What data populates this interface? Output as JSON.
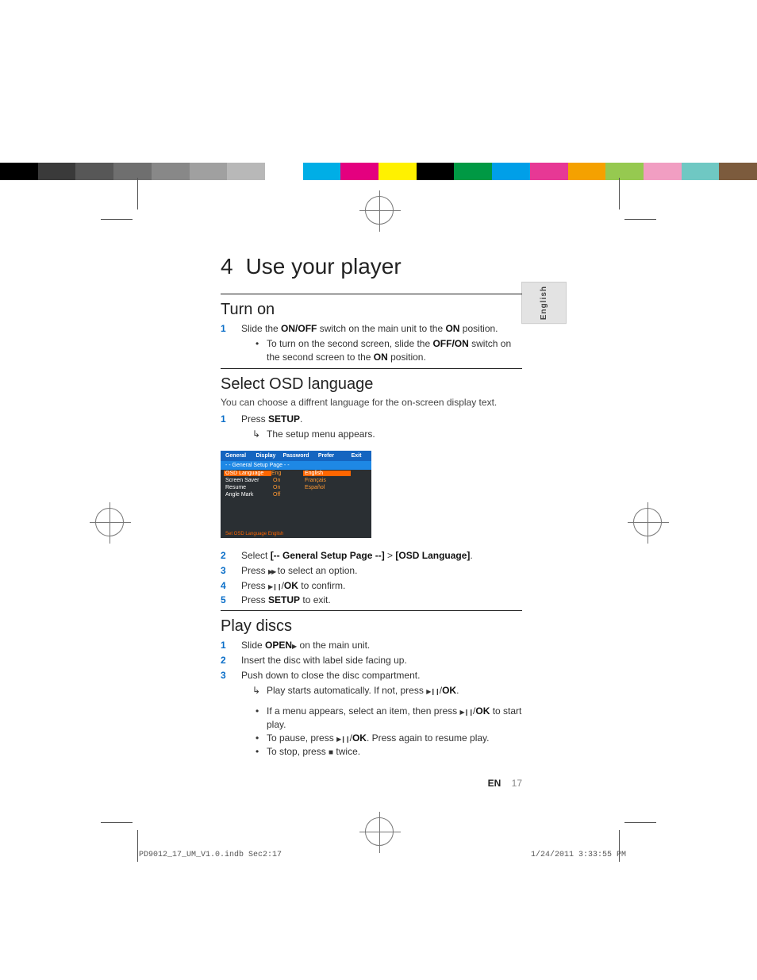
{
  "lang_tab": "English",
  "chapter": {
    "number": "4",
    "title": "Use your player"
  },
  "sections": {
    "turn_on": {
      "heading": "Turn on",
      "step1_pre": "Slide the ",
      "step1_bold1": "ON/OFF",
      "step1_mid": " switch on the main unit to the ",
      "step1_bold2": "ON",
      "step1_post": " position.",
      "sub_pre": "To turn on the second screen, slide the ",
      "sub_bold1": "OFF/ON",
      "sub_mid": " switch on the second screen to the ",
      "sub_bold2": "ON",
      "sub_post": " position."
    },
    "osd": {
      "heading": "Select OSD language",
      "intro": "You can choose a diffrent language for the on-screen display text.",
      "step1_pre": "Press ",
      "step1_bold": "SETUP",
      "step1_post": ".",
      "step1_sub": "The setup menu appears.",
      "step2_pre": "Select ",
      "step2_bold1": "[-- General Setup Page --]",
      "step2_mid": " > ",
      "step2_bold2": "[OSD Language]",
      "step2_post": ".",
      "step3": "Press  to select an option.",
      "step3_pre": "Press ",
      "step3_post": " to select an option.",
      "step4_pre": "Press ",
      "step4_mid": "/",
      "step4_bold": "OK",
      "step4_post": " to confirm.",
      "step5_pre": "Press ",
      "step5_bold": "SETUP",
      "step5_post": " to exit."
    },
    "play": {
      "heading": "Play discs",
      "step1_pre": "Slide ",
      "step1_bold": "OPEN",
      "step1_post": " on the main unit.",
      "step2": "Insert the disc with label side facing up.",
      "step3": "Push down to close the disc compartment.",
      "step3_sub_pre": "Play starts automatically. If not, press ",
      "step3_sub_bold": "OK",
      "step3_sub_post": ".",
      "b1_pre": "If a menu appears, select an item, then press ",
      "b1_bold": "OK",
      "b1_post": " to start play.",
      "b2_pre": "To pause, press ",
      "b2_bold": "OK",
      "b2_post": ". Press again to resume play.",
      "b3_pre": "To stop, press ",
      "b3_post": " twice."
    }
  },
  "osd_shot": {
    "tabs": [
      "General",
      "Display",
      "Password",
      "Prefer",
      "Exit"
    ],
    "subhead": "- -   General Setup Page   - -",
    "rows": [
      {
        "c1": "OSD  Language",
        "c2": "Eng",
        "c3": "English",
        "sel": true
      },
      {
        "c1": "Screen Saver",
        "c2": "On",
        "c3": "Français"
      },
      {
        "c1": "Resume",
        "c2": "On",
        "c3": "Español"
      },
      {
        "c1": "Angle Mark",
        "c2": "Off",
        "c3": ""
      }
    ],
    "foot": "Set OSD Language English"
  },
  "footer": {
    "lang": "EN",
    "page": "17"
  },
  "imprint": {
    "left": "PD9012_17_UM_V1.0.indb   Sec2:17",
    "right": "1/24/2011   3:33:55 PM"
  },
  "colorbar": [
    "#000",
    "#3a3a3a",
    "#575757",
    "#6f6f6f",
    "#888",
    "#a0a0a0",
    "#b8b8b8",
    "#fff",
    "#00aee6",
    "#e4007f",
    "#fff100",
    "#000",
    "#009944",
    "#009fe8",
    "#e73895",
    "#f5a100",
    "#96c950",
    "#f19ec2",
    "#6fc8c3",
    "#7c5b3d"
  ]
}
